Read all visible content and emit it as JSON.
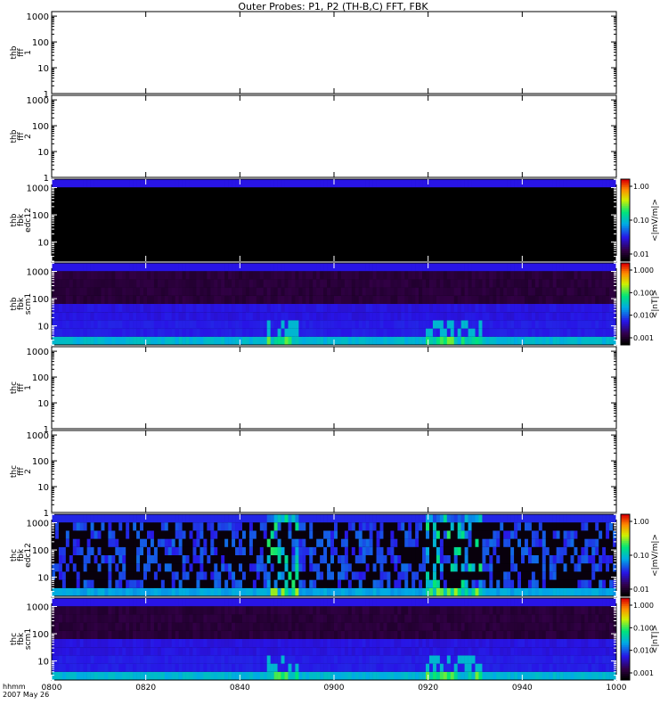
{
  "title": "Outer Probes: P1, P2 (TH-B,C) FFT, FBK",
  "chart_data": {
    "type": "heatmap",
    "title": "Outer Probes: P1, P2 (TH-B,C) FFT, FBK",
    "x_ticks": [
      "0800",
      "0820",
      "0840",
      "0900",
      "0920",
      "0940",
      "1000"
    ],
    "x_footer": [
      "hhmm",
      "2007 May 26"
    ],
    "y_scale": "log",
    "panels": [
      {
        "ylabel": [
          "thb",
          "fff",
          "1"
        ],
        "yticks": [
          "1",
          "10",
          "100",
          "1000"
        ],
        "ylim": [
          1,
          1500
        ],
        "colorbar": null,
        "filled": false
      },
      {
        "ylabel": [
          "thb",
          "fff",
          "2"
        ],
        "yticks": [
          "1",
          "10",
          "100",
          "1000"
        ],
        "ylim": [
          1,
          1500
        ],
        "colorbar": null,
        "filled": false
      },
      {
        "ylabel": [
          "thb",
          "fbk",
          "edc12"
        ],
        "yticks": [
          "10",
          "100",
          "1000"
        ],
        "ylim": [
          2,
          2048
        ],
        "filled": true,
        "pattern": "edc_quiet",
        "colorbar": {
          "label": "<|mV/m|>",
          "ticks": [
            "1.00",
            "0.10",
            "0.01"
          ]
        }
      },
      {
        "ylabel": [
          "thb",
          "fbk",
          "scm1"
        ],
        "yticks": [
          "10",
          "100",
          "1000"
        ],
        "ylim": [
          2,
          2048
        ],
        "filled": true,
        "pattern": "scm",
        "colorbar": {
          "label": "<|nT|>",
          "ticks": [
            "1.000",
            "0.100",
            "0.010",
            "0.001"
          ]
        }
      },
      {
        "ylabel": [
          "thc",
          "fff",
          "1"
        ],
        "yticks": [
          "1",
          "10",
          "100",
          "1000"
        ],
        "ylim": [
          1,
          1500
        ],
        "colorbar": null,
        "filled": false
      },
      {
        "ylabel": [
          "thc",
          "fff",
          "2"
        ],
        "yticks": [
          "1",
          "10",
          "100",
          "1000"
        ],
        "ylim": [
          1,
          1500
        ],
        "colorbar": null,
        "filled": false
      },
      {
        "ylabel": [
          "thc",
          "fbk",
          "edc12"
        ],
        "yticks": [
          "10",
          "100",
          "1000"
        ],
        "ylim": [
          2,
          2048
        ],
        "filled": true,
        "pattern": "edc_active",
        "colorbar": {
          "label": "<|mV/m|>",
          "ticks": [
            "1.00",
            "0.10",
            "0.01"
          ]
        }
      },
      {
        "ylabel": [
          "thc",
          "fbk",
          "scm1"
        ],
        "yticks": [
          "10",
          "100",
          "1000"
        ],
        "ylim": [
          2,
          2048
        ],
        "filled": true,
        "pattern": "scm2",
        "colorbar": {
          "label": "<|nT|>",
          "ticks": [
            "1.000",
            "0.100",
            "0.010",
            "0.001"
          ]
        }
      }
    ]
  }
}
